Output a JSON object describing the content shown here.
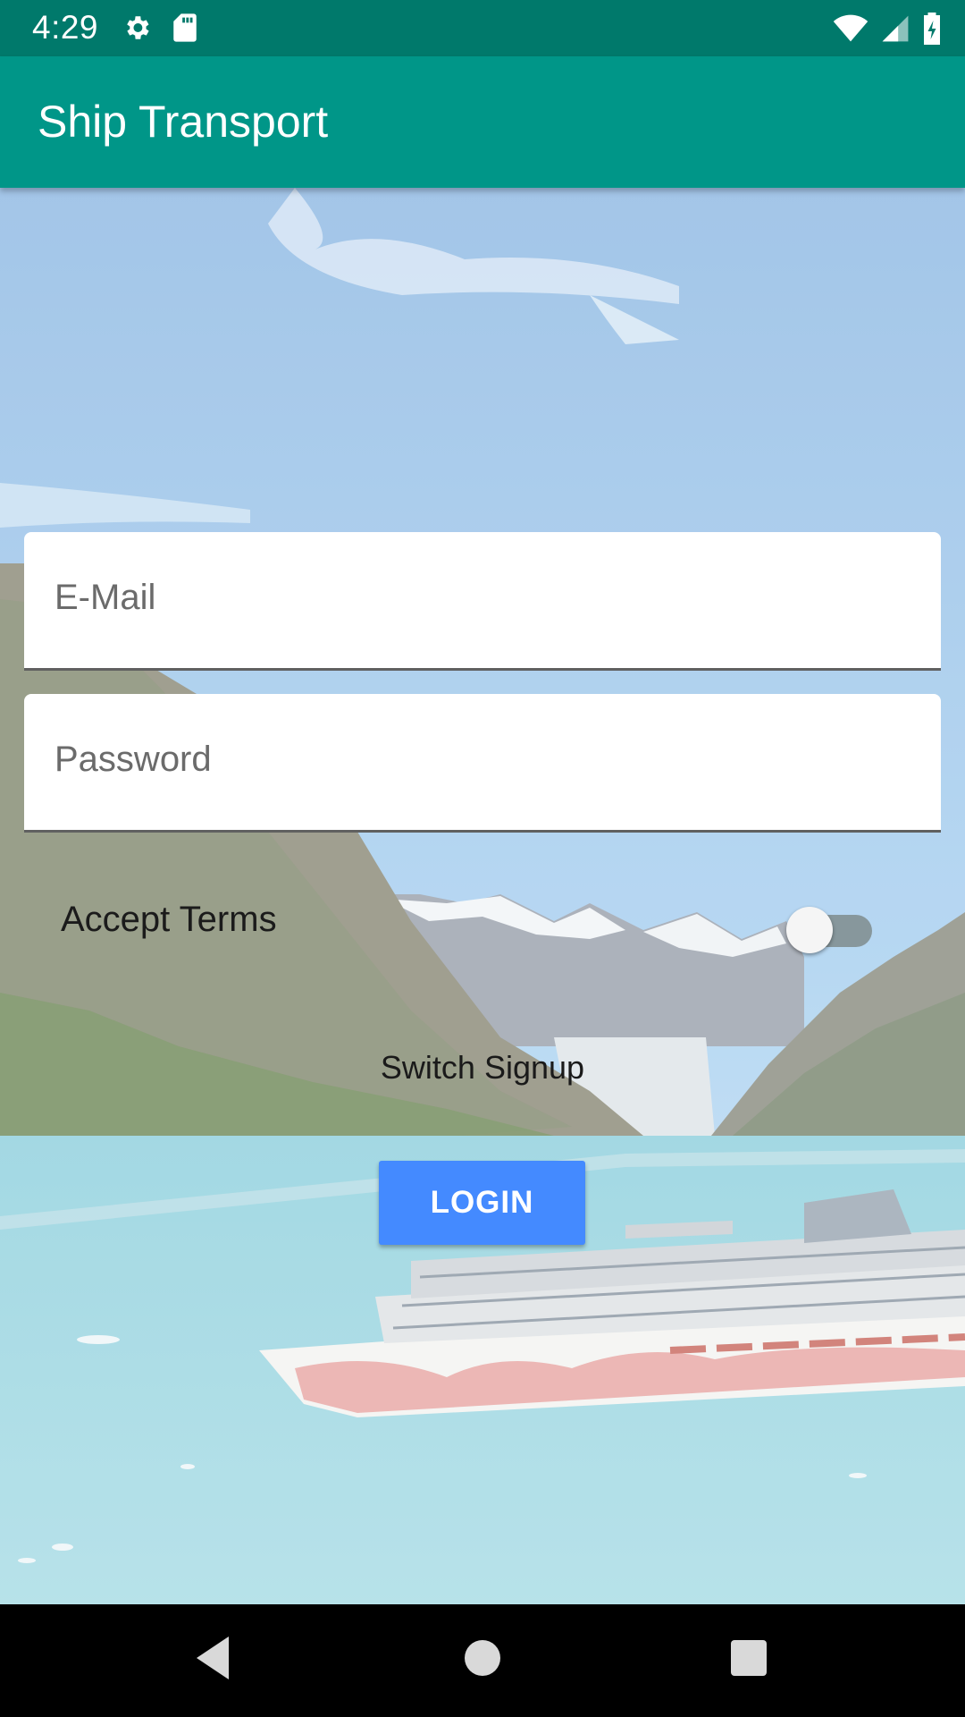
{
  "status_bar": {
    "time": "4:29",
    "left_icons": [
      "gear-icon",
      "sd-card-icon"
    ],
    "right_icons": [
      "wifi-icon",
      "signal-icon",
      "battery-icon"
    ]
  },
  "app_bar": {
    "title": "Ship Transport",
    "color": "#009688"
  },
  "form": {
    "email": {
      "placeholder": "E-Mail",
      "value": ""
    },
    "password": {
      "placeholder": "Password",
      "value": ""
    },
    "accept_terms": {
      "label": "Accept Terms",
      "checked": false
    },
    "switch_label": "Switch Signup",
    "login_label": "LOGIN",
    "login_color": "#448aff"
  },
  "nav_bar": {
    "buttons": [
      "back-icon",
      "home-icon",
      "recents-icon"
    ]
  }
}
